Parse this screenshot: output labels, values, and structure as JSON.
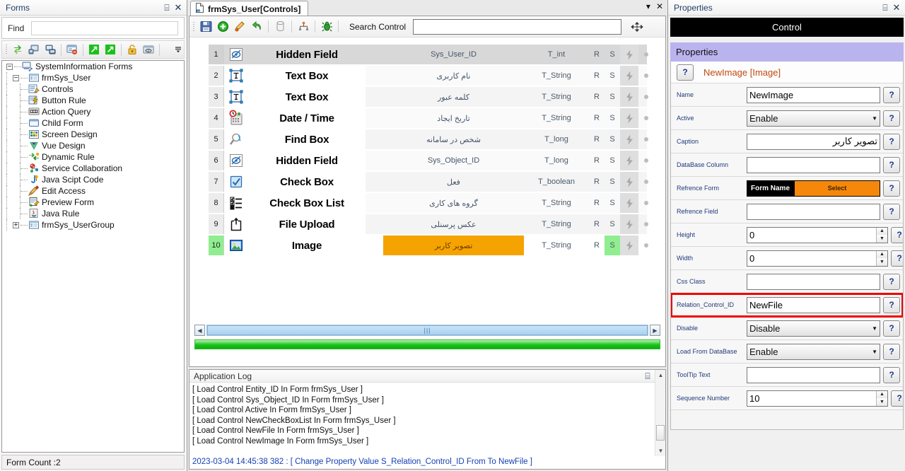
{
  "left_panel": {
    "title": "Forms",
    "pin_icon": "pin-icon",
    "close_icon": "close-icon",
    "find_label": "Find",
    "find_value": "",
    "find_placeholder": "",
    "toolbar_icons": [
      "refresh-icon",
      "connect-server-icon",
      "disconnect-server-icon",
      "form-remove-icon",
      "export-icon",
      "import-icon",
      "lock-icon",
      "deploy-icon",
      "overflow-icon"
    ],
    "status": "Form Count :2",
    "tree": [
      {
        "label": "SystemInformation Forms",
        "level": 0,
        "expander": "minus",
        "icon": "system-forms-icon"
      },
      {
        "label": "frmSys_User",
        "level": 1,
        "expander": "minus",
        "icon": "form-icon"
      },
      {
        "label": "Controls",
        "level": 2,
        "expander": "none",
        "icon": "controls-icon"
      },
      {
        "label": "Button Rule",
        "level": 2,
        "expander": "none",
        "icon": "button-rule-icon"
      },
      {
        "label": "Action Query",
        "level": 2,
        "expander": "none",
        "icon": "action-query-icon"
      },
      {
        "label": "Child Form",
        "level": 2,
        "expander": "none",
        "icon": "child-form-icon"
      },
      {
        "label": "Screen Design",
        "level": 2,
        "expander": "none",
        "icon": "screen-design-icon"
      },
      {
        "label": "Vue Design",
        "level": 2,
        "expander": "none",
        "icon": "vue-design-icon"
      },
      {
        "label": "Dynamic Rule",
        "level": 2,
        "expander": "none",
        "icon": "dynamic-rule-icon"
      },
      {
        "label": "Service Collaboration",
        "level": 2,
        "expander": "none",
        "icon": "service-collaboration-icon"
      },
      {
        "label": "Java Scipt Code",
        "level": 2,
        "expander": "none",
        "icon": "javascript-code-icon"
      },
      {
        "label": "Edit Access",
        "level": 2,
        "expander": "none",
        "icon": "edit-access-icon"
      },
      {
        "label": "Preview Form",
        "level": 2,
        "expander": "none",
        "icon": "preview-form-icon"
      },
      {
        "label": "Java Rule",
        "level": 2,
        "expander": "none",
        "icon": "java-rule-icon"
      },
      {
        "label": "frmSys_UserGroup",
        "level": 1,
        "expander": "plus",
        "icon": "form-icon"
      }
    ]
  },
  "center": {
    "tab": {
      "label": "frmSys_User[Controls]",
      "icon": "document-icon"
    },
    "tab_dropdown_icon": "chevron-down-icon",
    "tab_close_icon": "close-icon",
    "toolbar": {
      "icons": [
        "save-icon",
        "add-icon",
        "edit-icon",
        "undo-icon",
        "database-icon",
        "hierarchy-icon",
        "bug-icon"
      ],
      "search_label": "Search Control",
      "search_value": "",
      "search_placeholder": "",
      "move_icon": "move-icon"
    },
    "grid": {
      "rows": [
        {
          "num": "1",
          "icon": "hidden-field-icon",
          "type": "Hidden Field",
          "caption": "Sys_User_ID",
          "datatype": "T_int",
          "r": "R",
          "s": "S",
          "bolt": "bolt-icon",
          "dot": "dot-icon",
          "selected": false,
          "header": true,
          "caption_highlight": false
        },
        {
          "num": "2",
          "icon": "text-box-icon",
          "type": "Text Box",
          "caption": "نام کاربری",
          "datatype": "T_String",
          "r": "R",
          "s": "S",
          "bolt": "bolt-icon",
          "dot": "dot-icon",
          "selected": false,
          "header": false,
          "caption_highlight": false
        },
        {
          "num": "3",
          "icon": "text-box-icon",
          "type": "Text Box",
          "caption": "کلمه عبور",
          "datatype": "T_String",
          "r": "R",
          "s": "S",
          "bolt": "bolt-icon",
          "dot": "dot-icon",
          "selected": false,
          "header": false,
          "caption_highlight": false
        },
        {
          "num": "4",
          "icon": "date-time-icon",
          "type": "Date / Time",
          "caption": "تاریخ ایجاد",
          "datatype": "T_String",
          "r": "R",
          "s": "S",
          "bolt": "bolt-icon",
          "dot": "dot-icon",
          "selected": false,
          "header": false,
          "caption_highlight": false
        },
        {
          "num": "5",
          "icon": "find-box-icon",
          "type": "Find Box",
          "caption": "شخص در سامانه",
          "datatype": "T_long",
          "r": "R",
          "s": "S",
          "bolt": "bolt-icon",
          "dot": "dot-icon",
          "selected": false,
          "header": false,
          "caption_highlight": false
        },
        {
          "num": "6",
          "icon": "hidden-field-icon",
          "type": "Hidden Field",
          "caption": "Sys_Object_ID",
          "datatype": "T_long",
          "r": "R",
          "s": "S",
          "bolt": "bolt-icon",
          "dot": "dot-icon",
          "selected": false,
          "header": false,
          "caption_highlight": false
        },
        {
          "num": "7",
          "icon": "check-box-icon",
          "type": "Check Box",
          "caption": "فعل",
          "datatype": "T_boolean",
          "r": "R",
          "s": "S",
          "bolt": "bolt-icon",
          "dot": "dot-icon",
          "selected": false,
          "header": false,
          "caption_highlight": false
        },
        {
          "num": "8",
          "icon": "check-box-list-icon",
          "type": "Check Box List",
          "caption": "گروه های کاری",
          "datatype": "T_String",
          "r": "R",
          "s": "S",
          "bolt": "bolt-icon",
          "dot": "dot-icon",
          "selected": false,
          "header": false,
          "caption_highlight": false
        },
        {
          "num": "9",
          "icon": "file-upload-icon",
          "type": "File Upload",
          "caption": "عکس پرسنلی",
          "datatype": "T_String",
          "r": "R",
          "s": "S",
          "bolt": "bolt-icon",
          "dot": "dot-icon",
          "selected": false,
          "header": false,
          "caption_highlight": false
        },
        {
          "num": "10",
          "icon": "image-icon",
          "type": "Image",
          "caption": "تصویر کاربر",
          "datatype": "T_String",
          "r": "R",
          "s": "S",
          "bolt": "bolt-icon",
          "dot": "dot-icon",
          "selected": true,
          "header": false,
          "caption_highlight": true
        }
      ]
    },
    "hscroll": {
      "left_icon": "arrow-left-icon",
      "right_icon": "arrow-right-icon",
      "thumb_grip": "|||"
    },
    "log": {
      "title": "Application Log",
      "pin_icon": "pin-icon",
      "close_icon": "close-icon",
      "lines": [
        {
          "text": "[ Load Control Entity_ID In  Form frmSys_User ]",
          "blue": false
        },
        {
          "text": "[ Load Control Sys_Object_ID In  Form frmSys_User ]",
          "blue": false
        },
        {
          "text": "[ Load Control Active In  Form frmSys_User ]",
          "blue": false
        },
        {
          "text": "[ Load Control NewCheckBoxList In  Form frmSys_User ]",
          "blue": false
        },
        {
          "text": "[ Load Control NewFile In  Form frmSys_User ]",
          "blue": false
        },
        {
          "text": "[ Load Control NewImage In  Form frmSys_User ]",
          "blue": false
        },
        {
          "text": "",
          "blue": false
        },
        {
          "text": "2023-03-04 14:45:38 382 :  [ Change Property Value S_Relation_Control_ID From  To NewFile ]",
          "blue": true
        }
      ]
    }
  },
  "right_panel": {
    "title": "Properties",
    "pin_icon": "pin-icon",
    "close_icon": "close-icon",
    "control_bar": "Control",
    "section_header": "Properties",
    "control_name": "NewImage [Image]",
    "help_label": "?",
    "properties": [
      {
        "label": "Name",
        "kind": "text",
        "value": "NewImage"
      },
      {
        "label": "Active",
        "kind": "select",
        "value": "Enable"
      },
      {
        "label": "Caption",
        "kind": "text",
        "value": "تصویر کاربر",
        "rtl": true
      },
      {
        "label": "DataBase Column",
        "kind": "text",
        "value": ""
      },
      {
        "label": "Refrence Form",
        "kind": "ref",
        "value": "Form Name",
        "button": "Select"
      },
      {
        "label": "Refrence Field",
        "kind": "text",
        "value": ""
      },
      {
        "label": "Height",
        "kind": "spin",
        "value": "0"
      },
      {
        "label": "Width",
        "kind": "spin",
        "value": "0"
      },
      {
        "label": "Css Class",
        "kind": "text",
        "value": ""
      },
      {
        "label": "Relation_Control_ID",
        "kind": "text",
        "value": "NewFile",
        "highlight": true
      },
      {
        "label": "Disable",
        "kind": "select",
        "value": "Disable"
      },
      {
        "label": "Load From DataBase",
        "kind": "select",
        "value": "Enable"
      },
      {
        "label": "ToolTip Text",
        "kind": "text",
        "value": ""
      },
      {
        "label": "Sequence Number",
        "kind": "spin",
        "value": "10"
      }
    ]
  },
  "colors": {
    "accent_orange": "#f5a300",
    "selected_green": "#90ee90",
    "highlight_red": "#ee0000",
    "section_purple": "#b9b3ee",
    "log_blue": "#1641b4",
    "label_blue": "#22397a",
    "control_name_orange": "#c0490f"
  }
}
